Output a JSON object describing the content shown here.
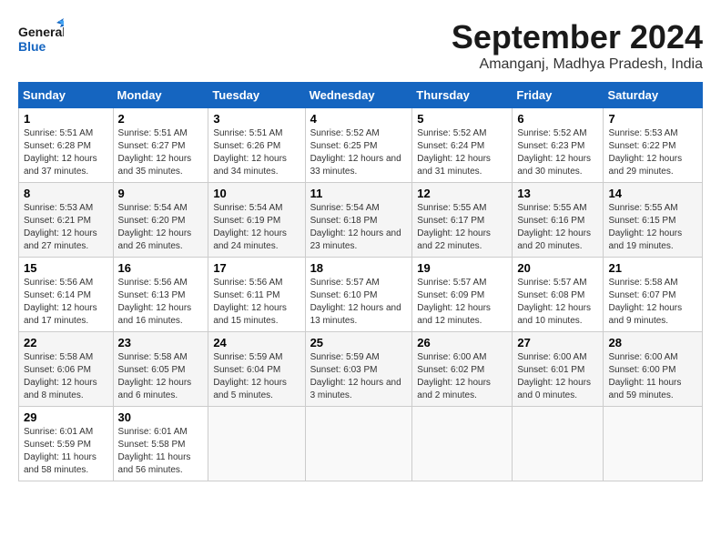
{
  "header": {
    "logo_line1": "General",
    "logo_line2": "Blue",
    "month_title": "September 2024",
    "subtitle": "Amanganj, Madhya Pradesh, India"
  },
  "weekdays": [
    "Sunday",
    "Monday",
    "Tuesday",
    "Wednesday",
    "Thursday",
    "Friday",
    "Saturday"
  ],
  "weeks": [
    [
      {
        "day": "1",
        "sunrise": "5:51 AM",
        "sunset": "6:28 PM",
        "daylight": "12 hours and 37 minutes."
      },
      {
        "day": "2",
        "sunrise": "5:51 AM",
        "sunset": "6:27 PM",
        "daylight": "12 hours and 35 minutes."
      },
      {
        "day": "3",
        "sunrise": "5:51 AM",
        "sunset": "6:26 PM",
        "daylight": "12 hours and 34 minutes."
      },
      {
        "day": "4",
        "sunrise": "5:52 AM",
        "sunset": "6:25 PM",
        "daylight": "12 hours and 33 minutes."
      },
      {
        "day": "5",
        "sunrise": "5:52 AM",
        "sunset": "6:24 PM",
        "daylight": "12 hours and 31 minutes."
      },
      {
        "day": "6",
        "sunrise": "5:52 AM",
        "sunset": "6:23 PM",
        "daylight": "12 hours and 30 minutes."
      },
      {
        "day": "7",
        "sunrise": "5:53 AM",
        "sunset": "6:22 PM",
        "daylight": "12 hours and 29 minutes."
      }
    ],
    [
      {
        "day": "8",
        "sunrise": "5:53 AM",
        "sunset": "6:21 PM",
        "daylight": "12 hours and 27 minutes."
      },
      {
        "day": "9",
        "sunrise": "5:54 AM",
        "sunset": "6:20 PM",
        "daylight": "12 hours and 26 minutes."
      },
      {
        "day": "10",
        "sunrise": "5:54 AM",
        "sunset": "6:19 PM",
        "daylight": "12 hours and 24 minutes."
      },
      {
        "day": "11",
        "sunrise": "5:54 AM",
        "sunset": "6:18 PM",
        "daylight": "12 hours and 23 minutes."
      },
      {
        "day": "12",
        "sunrise": "5:55 AM",
        "sunset": "6:17 PM",
        "daylight": "12 hours and 22 minutes."
      },
      {
        "day": "13",
        "sunrise": "5:55 AM",
        "sunset": "6:16 PM",
        "daylight": "12 hours and 20 minutes."
      },
      {
        "day": "14",
        "sunrise": "5:55 AM",
        "sunset": "6:15 PM",
        "daylight": "12 hours and 19 minutes."
      }
    ],
    [
      {
        "day": "15",
        "sunrise": "5:56 AM",
        "sunset": "6:14 PM",
        "daylight": "12 hours and 17 minutes."
      },
      {
        "day": "16",
        "sunrise": "5:56 AM",
        "sunset": "6:13 PM",
        "daylight": "12 hours and 16 minutes."
      },
      {
        "day": "17",
        "sunrise": "5:56 AM",
        "sunset": "6:11 PM",
        "daylight": "12 hours and 15 minutes."
      },
      {
        "day": "18",
        "sunrise": "5:57 AM",
        "sunset": "6:10 PM",
        "daylight": "12 hours and 13 minutes."
      },
      {
        "day": "19",
        "sunrise": "5:57 AM",
        "sunset": "6:09 PM",
        "daylight": "12 hours and 12 minutes."
      },
      {
        "day": "20",
        "sunrise": "5:57 AM",
        "sunset": "6:08 PM",
        "daylight": "12 hours and 10 minutes."
      },
      {
        "day": "21",
        "sunrise": "5:58 AM",
        "sunset": "6:07 PM",
        "daylight": "12 hours and 9 minutes."
      }
    ],
    [
      {
        "day": "22",
        "sunrise": "5:58 AM",
        "sunset": "6:06 PM",
        "daylight": "12 hours and 8 minutes."
      },
      {
        "day": "23",
        "sunrise": "5:58 AM",
        "sunset": "6:05 PM",
        "daylight": "12 hours and 6 minutes."
      },
      {
        "day": "24",
        "sunrise": "5:59 AM",
        "sunset": "6:04 PM",
        "daylight": "12 hours and 5 minutes."
      },
      {
        "day": "25",
        "sunrise": "5:59 AM",
        "sunset": "6:03 PM",
        "daylight": "12 hours and 3 minutes."
      },
      {
        "day": "26",
        "sunrise": "6:00 AM",
        "sunset": "6:02 PM",
        "daylight": "12 hours and 2 minutes."
      },
      {
        "day": "27",
        "sunrise": "6:00 AM",
        "sunset": "6:01 PM",
        "daylight": "12 hours and 0 minutes."
      },
      {
        "day": "28",
        "sunrise": "6:00 AM",
        "sunset": "6:00 PM",
        "daylight": "11 hours and 59 minutes."
      }
    ],
    [
      {
        "day": "29",
        "sunrise": "6:01 AM",
        "sunset": "5:59 PM",
        "daylight": "11 hours and 58 minutes."
      },
      {
        "day": "30",
        "sunrise": "6:01 AM",
        "sunset": "5:58 PM",
        "daylight": "11 hours and 56 minutes."
      },
      null,
      null,
      null,
      null,
      null
    ]
  ]
}
